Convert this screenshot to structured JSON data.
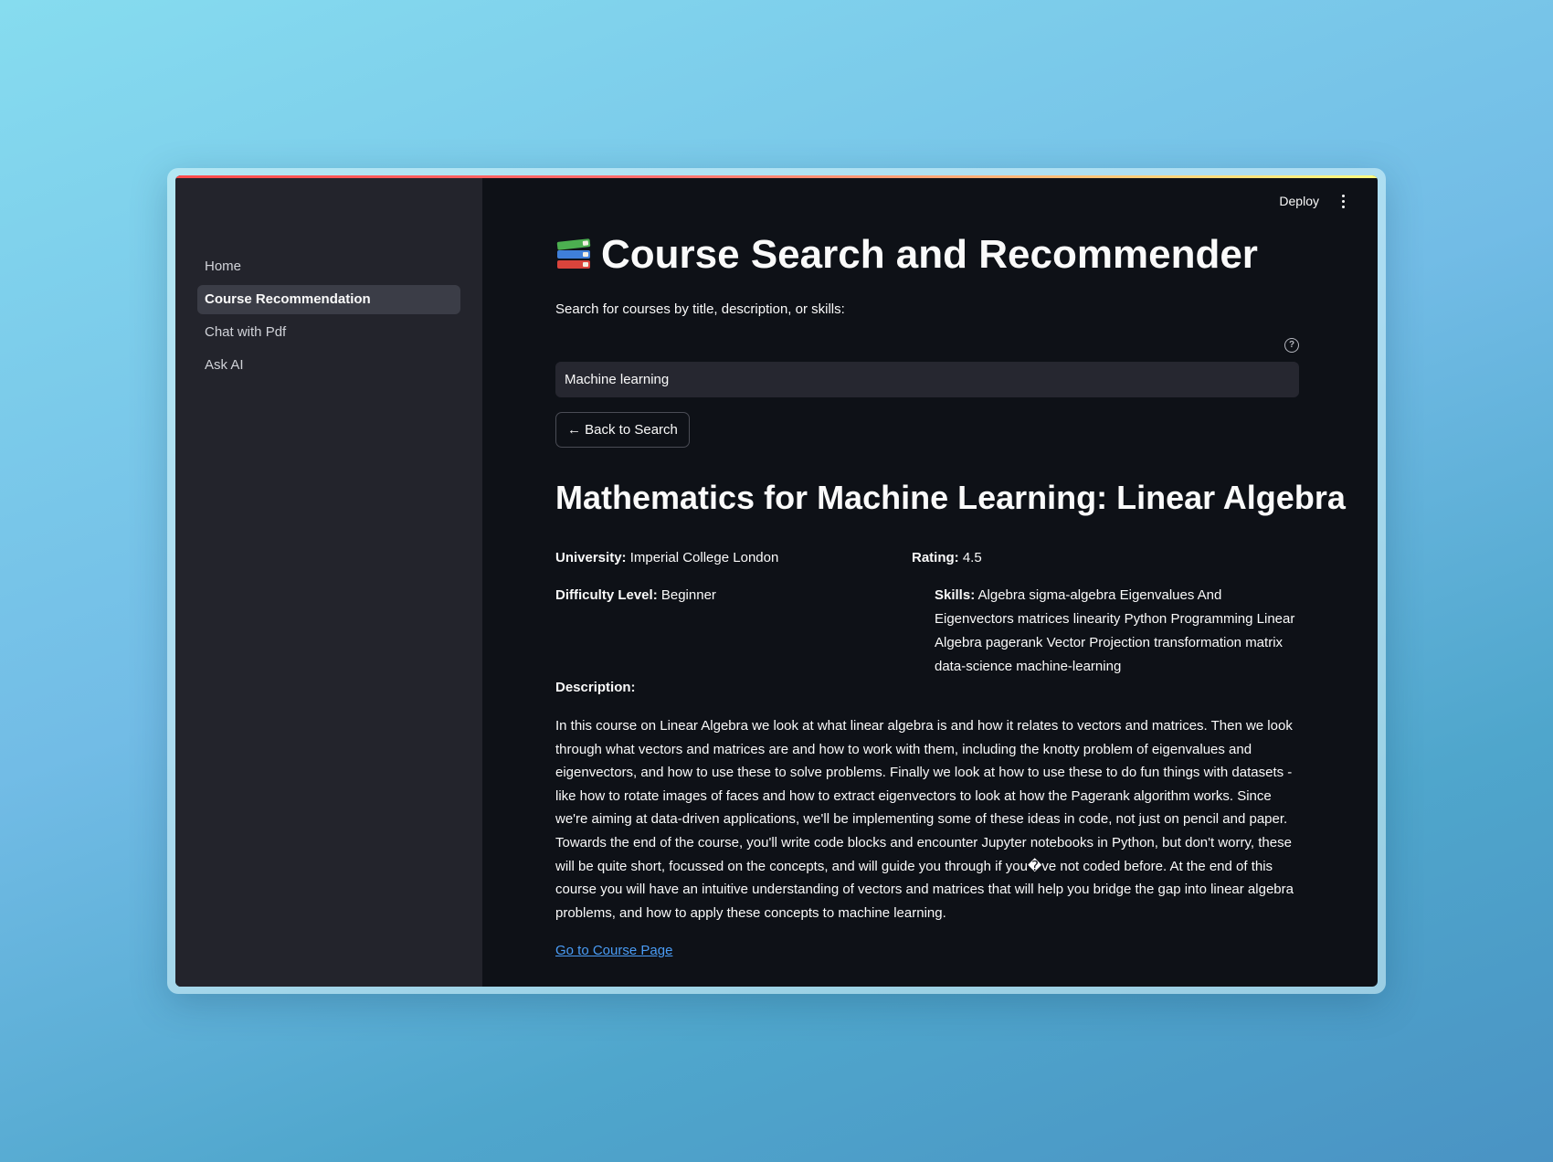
{
  "sidebar": {
    "items": [
      {
        "label": "Home",
        "active": false
      },
      {
        "label": "Course Recommendation",
        "active": true
      },
      {
        "label": "Chat with Pdf",
        "active": false
      },
      {
        "label": "Ask AI",
        "active": false
      }
    ]
  },
  "header": {
    "deploy_label": "Deploy",
    "menu_icon": "kebab-menu-icon"
  },
  "main": {
    "title": "Course Search and Recommender",
    "title_icon": "books-icon",
    "search_label": "Search for courses by title, description, or skills:",
    "help_icon": "question-circle-icon",
    "search_value": "Machine learning",
    "back_button_label": "← Back to Search"
  },
  "course": {
    "title": "Mathematics for Machine Learning: Linear Algebra",
    "university_label": "University:",
    "university": "Imperial College London",
    "rating_label": "Rating:",
    "rating": "4.5",
    "difficulty_label": "Difficulty Level:",
    "difficulty": "Beginner",
    "skills_label": "Skills:",
    "skills": "Algebra sigma-algebra Eigenvalues And Eigenvectors matrices linearity Python Programming Linear Algebra pagerank Vector Projection transformation matrix data-science machine-learning",
    "description_label": "Description:",
    "description": "In this course on Linear Algebra we look at what linear algebra is and how it relates to vectors and matrices. Then we look through what vectors and matrices are and how to work with them, including the knotty problem of eigenvalues and eigenvectors, and how to use these to solve problems. Finally we look at how to use these to do fun things with datasets - like how to rotate images of faces and how to extract eigenvectors to look at how the Pagerank algorithm works. Since we're aiming at data-driven applications, we'll be implementing some of these ideas in code, not just on pencil and paper. Towards the end of the course, you'll write code blocks and encounter Jupyter notebooks in Python, but don't worry, these will be quite short, focussed on the concepts, and will guide you through if you�ve not coded before. At the end of this course you will have an intuitive understanding of vectors and matrices that will help you bridge the gap into linear algebra problems, and how to apply these concepts to machine learning.",
    "link_label": "Go to Course Page"
  },
  "colors": {
    "background": "#0e1117",
    "sidebar": "#23242c",
    "accent_link": "#4a9cf5",
    "active_nav": "#3b3d47"
  }
}
